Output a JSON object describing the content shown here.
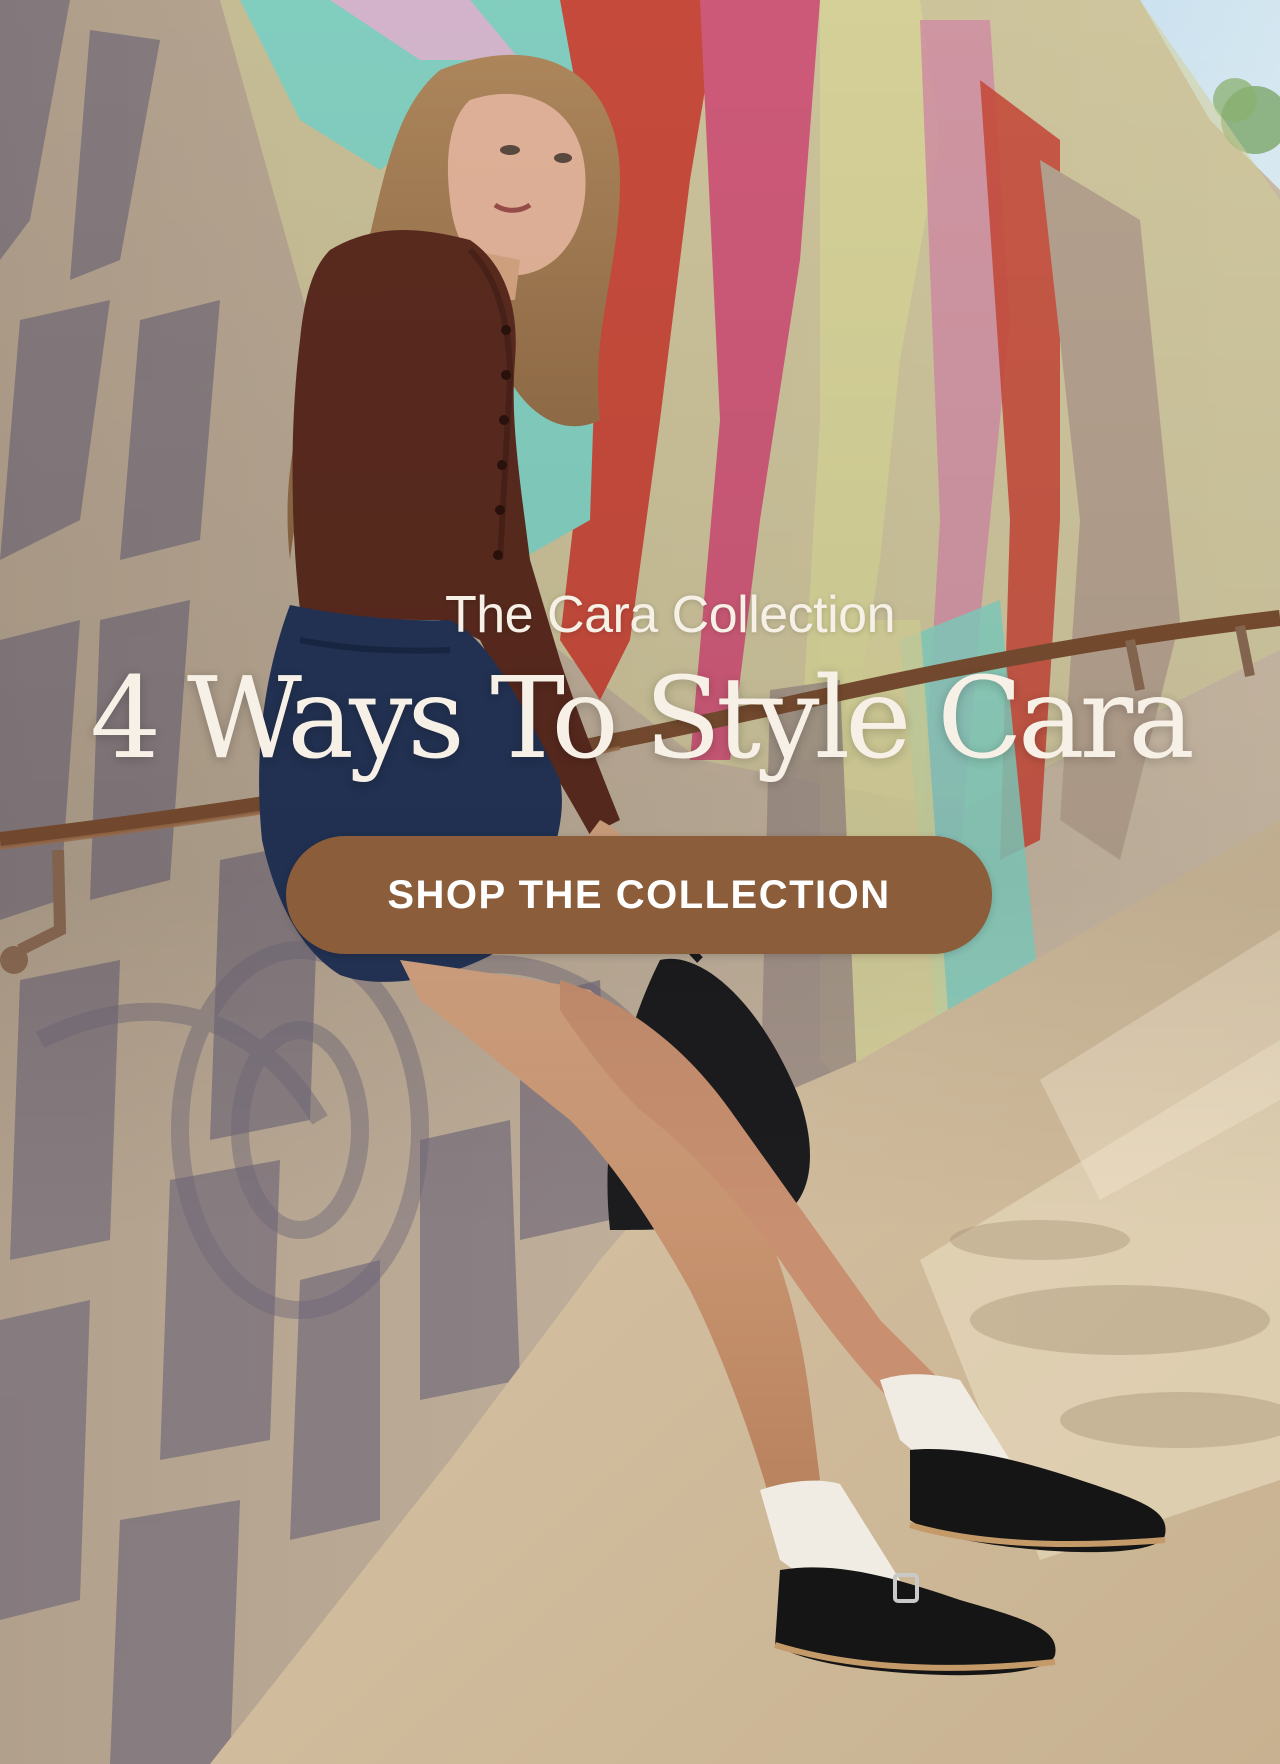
{
  "hero": {
    "eyebrow": "The Cara Collection",
    "headline": "4 Ways To Style Cara",
    "cta_label": "SHOP THE COLLECTION",
    "cta_color": "#8b5d3a",
    "text_color": "#f6f0e6"
  }
}
